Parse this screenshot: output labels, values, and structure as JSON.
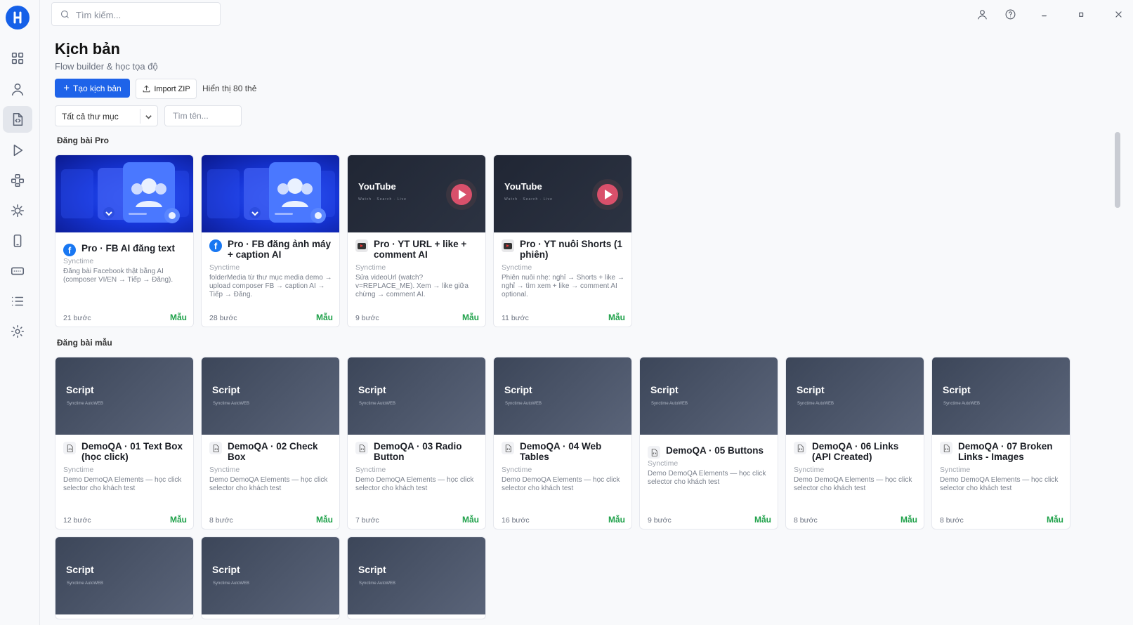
{
  "top": {
    "search_placeholder": "Tìm kiếm..."
  },
  "header": {
    "title": "Kịch bản",
    "subtitle": "Flow builder & học tọa độ",
    "create_button": "Tạo kịch bản",
    "import_button": "Import ZIP",
    "count_text": "Hiển thị 80 thẻ",
    "folder_select": "Tất cả thư mục",
    "name_placeholder": "Tìm tên..."
  },
  "sections": [
    {
      "title": "Đăng bài Pro",
      "cards": [
        {
          "thumb": "fb",
          "icon": "facebook-icon",
          "title": "Pro · FB AI đăng text",
          "author": "Synctime",
          "desc": "Đăng bài Facebook thật bằng AI (composer VI/EN → Tiếp → Đăng).",
          "steps": "21 bước",
          "tag": "Mẫu"
        },
        {
          "thumb": "fb",
          "icon": "facebook-icon",
          "title": "Pro · FB đăng ảnh máy + caption AI",
          "author": "Synctime",
          "desc": "folderMedia từ thư mục media demo → upload composer FB → caption AI → Tiếp → Đăng.",
          "steps": "28 bước",
          "tag": "Mẫu"
        },
        {
          "thumb": "yt",
          "thumb_text": "YouTube",
          "thumb_sub": "Watch · Search · Live",
          "icon": "youtube-icon",
          "title": "Pro · YT URL + like + comment AI",
          "author": "Synctime",
          "desc": "Sửa videoUrl (watch?v=REPLACE_ME). Xem → like giữa chừng → comment AI.",
          "steps": "9 bước",
          "tag": "Mẫu"
        },
        {
          "thumb": "yt",
          "thumb_text": "YouTube",
          "thumb_sub": "Watch · Search · Live",
          "icon": "youtube-icon",
          "title": "Pro · YT nuôi Shorts (1 phiên)",
          "author": "Synctime",
          "desc": "Phiên nuôi nhẹ: nghỉ → Shorts + like → nghỉ → tìm xem + like → comment AI optional.",
          "steps": "11 bước",
          "tag": "Mẫu"
        }
      ]
    },
    {
      "title": "Đăng bài mẫu",
      "cards": [
        {
          "thumb": "script",
          "thumb_text": "Script",
          "thumb_sub": "Synctime AutoWEB",
          "icon": "script-file-icon",
          "title": "DemoQA · 01 Text Box (học click)",
          "author": "Synctime",
          "desc": "Demo DemoQA Elements — học click selector cho khách test",
          "steps": "12 bước",
          "tag": "Mẫu"
        },
        {
          "thumb": "script",
          "thumb_text": "Script",
          "thumb_sub": "Synctime AutoWEB",
          "icon": "script-file-icon",
          "title": "DemoQA · 02 Check Box",
          "author": "Synctime",
          "desc": "Demo DemoQA Elements — học click selector cho khách test",
          "steps": "8 bước",
          "tag": "Mẫu"
        },
        {
          "thumb": "script",
          "thumb_text": "Script",
          "thumb_sub": "Synctime AutoWEB",
          "icon": "script-file-icon",
          "title": "DemoQA · 03 Radio Button",
          "author": "Synctime",
          "desc": "Demo DemoQA Elements — học click selector cho khách test",
          "steps": "7 bước",
          "tag": "Mẫu"
        },
        {
          "thumb": "script",
          "thumb_text": "Script",
          "thumb_sub": "Synctime AutoWEB",
          "icon": "script-file-icon",
          "title": "DemoQA · 04 Web Tables",
          "author": "Synctime",
          "desc": "Demo DemoQA Elements — học click selector cho khách test",
          "steps": "16 bước",
          "tag": "Mẫu"
        },
        {
          "thumb": "script",
          "thumb_text": "Script",
          "thumb_sub": "Synctime AutoWEB",
          "icon": "script-file-icon",
          "title": "DemoQA · 05 Buttons",
          "author": "Synctime",
          "desc": "Demo DemoQA Elements — học click selector cho khách test",
          "steps": "9 bước",
          "tag": "Mẫu"
        },
        {
          "thumb": "script",
          "thumb_text": "Script",
          "thumb_sub": "Synctime AutoWEB",
          "icon": "script-file-icon",
          "title": "DemoQA · 06 Links (API Created)",
          "author": "Synctime",
          "desc": "Demo DemoQA Elements — học click selector cho khách test",
          "steps": "8 bước",
          "tag": "Mẫu"
        },
        {
          "thumb": "script",
          "thumb_text": "Script",
          "thumb_sub": "Synctime AutoWEB",
          "icon": "script-file-icon",
          "title": "DemoQA · 07 Broken Links - Images",
          "author": "Synctime",
          "desc": "Demo DemoQA Elements — học click selector cho khách test",
          "steps": "8 bước",
          "tag": "Mẫu"
        }
      ]
    },
    {
      "title": "",
      "cards": [
        {
          "thumb": "script",
          "thumb_text": "Script",
          "thumb_sub": "Synctime AutoWEB"
        },
        {
          "thumb": "script",
          "thumb_text": "Script",
          "thumb_sub": "Synctime AutoWEB"
        },
        {
          "thumb": "script",
          "thumb_text": "Script",
          "thumb_sub": "Synctime AutoWEB"
        }
      ]
    }
  ]
}
